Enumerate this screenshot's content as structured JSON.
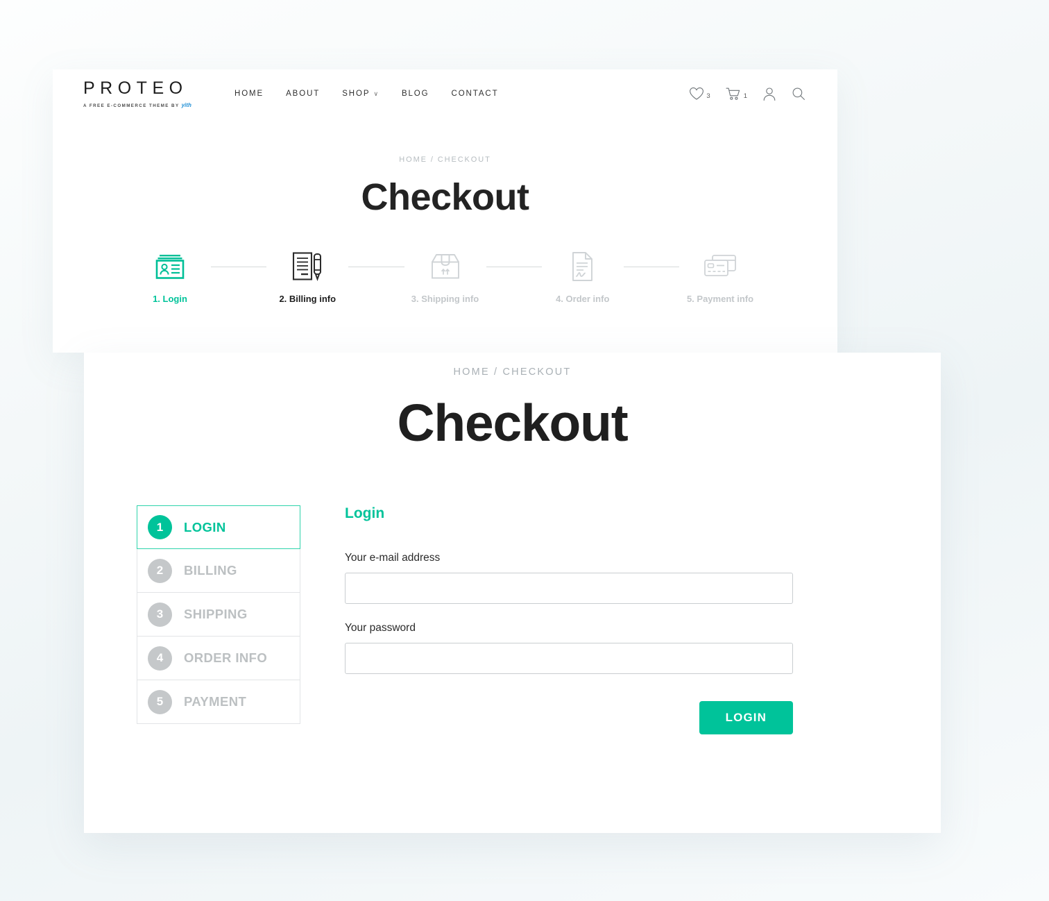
{
  "brand": {
    "name": "PROTEO",
    "tagline_prefix": "A FREE E-COMMERCE THEME BY",
    "tagline_vendor": "yith"
  },
  "nav": {
    "items": [
      {
        "label": "HOME",
        "has_caret": false
      },
      {
        "label": "ABOUT",
        "has_caret": false
      },
      {
        "label": "SHOP",
        "has_caret": true,
        "caret": "∨"
      },
      {
        "label": "BLOG",
        "has_caret": false
      },
      {
        "label": "CONTACT",
        "has_caret": false
      }
    ]
  },
  "header_tools": {
    "wishlist_icon": "heart-icon",
    "wishlist_count": "3",
    "cart_icon": "cart-icon",
    "cart_count": "1",
    "account_icon": "user-icon",
    "search_icon": "search-icon"
  },
  "hero": {
    "breadcrumb": "HOME / CHECKOUT",
    "title": "Checkout"
  },
  "steps": [
    {
      "label": "1. Login",
      "icon": "id-card-icon",
      "state": "active"
    },
    {
      "label": "2. Billing info",
      "icon": "document-pen-icon",
      "state": "current"
    },
    {
      "label": "3. Shipping info",
      "icon": "box-icon",
      "state": "idle"
    },
    {
      "label": "4. Order info",
      "icon": "signed-doc-icon",
      "state": "idle"
    },
    {
      "label": "5. Payment info",
      "icon": "credit-cards-icon",
      "state": "idle"
    }
  ],
  "panel": {
    "breadcrumb": "HOME / CHECKOUT",
    "title": "Checkout"
  },
  "sidebar_steps": [
    {
      "number": "1",
      "label": "LOGIN",
      "state": "active"
    },
    {
      "number": "2",
      "label": "BILLING",
      "state": "idle"
    },
    {
      "number": "3",
      "label": "SHIPPING",
      "state": "idle"
    },
    {
      "number": "4",
      "label": "ORDER INFO",
      "state": "idle"
    },
    {
      "number": "5",
      "label": "PAYMENT",
      "state": "idle"
    }
  ],
  "login_form": {
    "heading": "Login",
    "email_label": "Your e-mail address",
    "email_value": "",
    "email_placeholder": "",
    "password_label": "Your password",
    "password_value": "",
    "password_placeholder": "",
    "submit_label": "LOGIN"
  },
  "colors": {
    "accent": "#00c39a",
    "accent_border": "#2ed3ab",
    "muted": "#c3c7ca",
    "text_dark": "#1d1d1d",
    "brand_link": "#1f8fd6"
  }
}
